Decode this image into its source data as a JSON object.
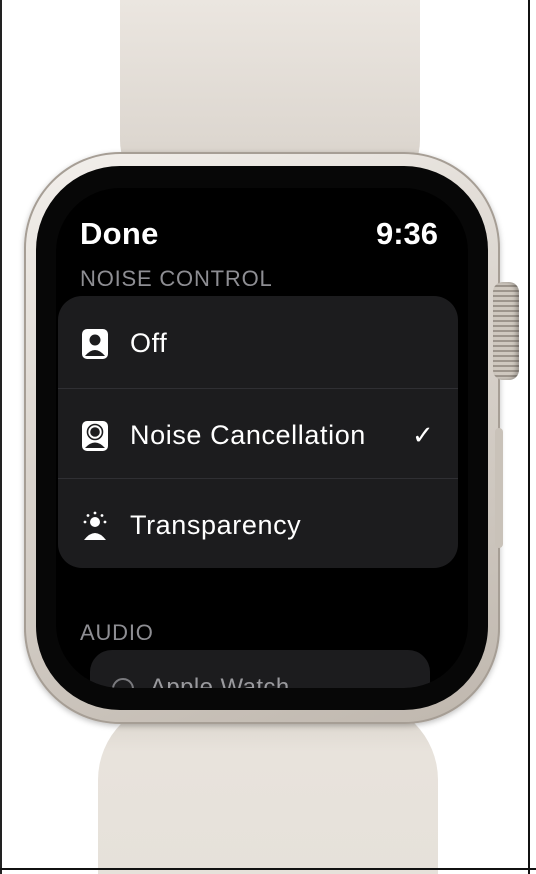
{
  "watch": {
    "status": {
      "done_label": "Done",
      "time": "9:36"
    },
    "noise_control": {
      "header": "NOISE CONTROL",
      "options": [
        {
          "label": "Off",
          "icon": "person-icon",
          "selected": false
        },
        {
          "label": "Noise Cancellation",
          "icon": "person-noise-cancellation-icon",
          "selected": true,
          "check": "✓"
        },
        {
          "label": "Transparency",
          "icon": "person-transparency-icon",
          "selected": false
        }
      ]
    },
    "audio": {
      "header": "AUDIO",
      "first_item": {
        "label": "Apple Watch",
        "icon": "circle-icon"
      }
    }
  },
  "colors": {
    "screen_bg": "#000000",
    "card_bg": "#1c1c1e",
    "section_header": "#8e8e93",
    "text": "#ffffff",
    "case": "#d9d3cc"
  }
}
